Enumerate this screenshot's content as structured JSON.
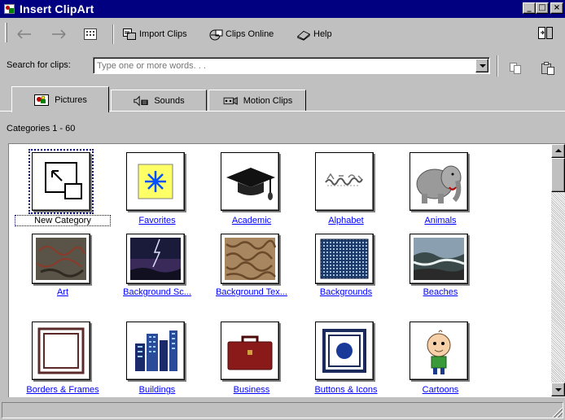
{
  "window": {
    "title": "Insert ClipArt",
    "controls": {
      "minimize": "_",
      "maximize": "□",
      "close": "×"
    }
  },
  "toolbar": {
    "back_icon": "back-arrow-icon",
    "forward_icon": "forward-arrow-icon",
    "all_categories_icon": "all-categories-icon",
    "import_clips_label": "Import Clips",
    "clips_online_label": "Clips Online",
    "help_label": "Help",
    "change_size_icon": "change-window-size-icon"
  },
  "search": {
    "label": "Search for clips:",
    "placeholder": "Type one or more words. . .",
    "value": ""
  },
  "tabs": [
    {
      "label": "Pictures",
      "icon": "pictures-icon",
      "active": true
    },
    {
      "label": "Sounds",
      "icon": "sounds-icon",
      "active": false
    },
    {
      "label": "Motion Clips",
      "icon": "motion-clips-icon",
      "active": false
    }
  ],
  "categories_range": "Categories 1 - 60",
  "categories": [
    {
      "label": "New Category",
      "icon": "new-category-icon",
      "selected": true
    },
    {
      "label": "Favorites",
      "icon": "favorites-icon"
    },
    {
      "label": "Academic",
      "icon": "academic-cap-icon"
    },
    {
      "label": "Alphabet",
      "icon": "alphabet-icon"
    },
    {
      "label": "Animals",
      "icon": "elephant-icon"
    },
    {
      "label": "Art",
      "icon": "art-photo-icon"
    },
    {
      "label": "Background Sc...",
      "icon": "background-scenes-icon"
    },
    {
      "label": "Background Tex...",
      "icon": "background-textures-icon"
    },
    {
      "label": "Backgrounds",
      "icon": "backgrounds-icon"
    },
    {
      "label": "Beaches",
      "icon": "beaches-icon"
    },
    {
      "label": "Borders & Frames",
      "icon": "borders-frames-icon"
    },
    {
      "label": "Buildings",
      "icon": "buildings-icon"
    },
    {
      "label": "Business",
      "icon": "briefcase-icon"
    },
    {
      "label": "Buttons & Icons",
      "icon": "buttons-icons-icon"
    },
    {
      "label": "Cartoons",
      "icon": "cartoon-character-icon"
    }
  ]
}
